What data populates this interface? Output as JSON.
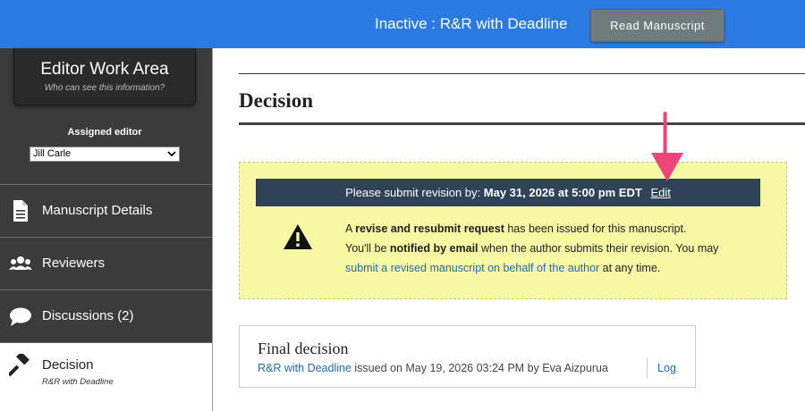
{
  "topbar": {
    "status": "Inactive : R&R with Deadline",
    "read_button": "Read Manuscript"
  },
  "sidebar": {
    "work_area_title": "Editor Work Area",
    "work_area_sub": "Who can see this information?",
    "assigned_label": "Assigned editor",
    "assigned_editor": "Jill Carle",
    "items": [
      {
        "label": "Manuscript Details",
        "icon": "document-icon"
      },
      {
        "label": "Reviewers",
        "icon": "people-icon"
      },
      {
        "label": "Discussions (2)",
        "icon": "speech-bubble-icon"
      },
      {
        "label": "Decision",
        "sub": "R&R with Deadline",
        "icon": "gavel-icon"
      }
    ]
  },
  "main": {
    "title": "Decision",
    "notice": {
      "bar_prefix": "Please submit revision by:",
      "deadline": "May 31, 2026 at 5:00 pm EDT",
      "edit": "Edit",
      "line1_a": "A ",
      "line1_b": "revise and resubmit request",
      "line1_c": " has been issued for this manuscript.",
      "line2_a": "You'll be ",
      "line2_b": "notified by email",
      "line2_c": " when the author submits their revision. You may",
      "line3_link": "submit a revised manuscript on behalf of the author",
      "line3_c": " at any time."
    },
    "final": {
      "title": "Final decision",
      "decision_link": "R&R with Deadline",
      "meta": " issued on May 19, 2026 03:24 PM by Eva Aizpurua",
      "log": "Log"
    }
  },
  "colors": {
    "topbar": "#2a7ae2",
    "sidebar": "#3b3b3b",
    "notice_bg": "#f7f8a3",
    "notice_bar": "#2f4257",
    "link": "#1f6bb8",
    "arrow": "#f0457a"
  }
}
